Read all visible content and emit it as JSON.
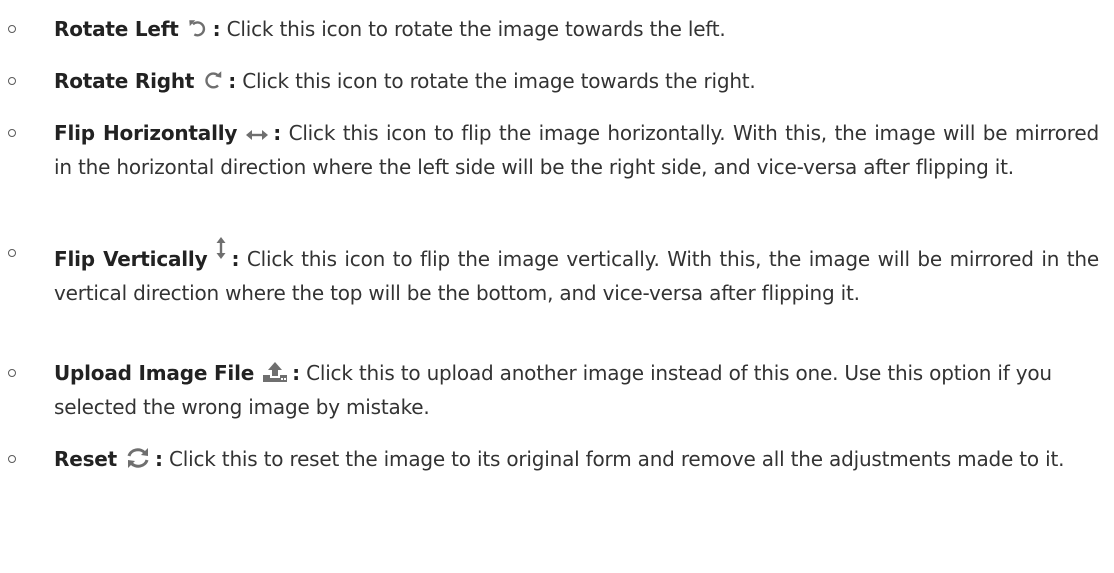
{
  "items": [
    {
      "term": "Rotate Left",
      "icon": "rotate-left-icon",
      "description": "Click this icon to rotate the image towards the left."
    },
    {
      "term": "Rotate Right",
      "icon": "rotate-right-icon",
      "description": "Click this icon to rotate the image towards the right."
    },
    {
      "term": "Flip Horizontally",
      "icon": "flip-horizontal-icon",
      "description": "Click this icon to flip the image horizontally. With this, the image will be mirrored in the horizontal direction where the left side will be the right side, and vice-versa after flipping it."
    },
    {
      "term": "Flip Vertically",
      "icon": "flip-vertical-icon",
      "description": "Click this icon to flip the image vertically. With this, the image will be mirrored in the vertical direction where the top will be the bottom, and vice-versa after flipping it."
    },
    {
      "term": "Upload Image File",
      "icon": "upload-icon",
      "description": "Click this to upload another image instead of this one. Use this option if you selected the wrong image by mistake."
    },
    {
      "term": "Reset",
      "icon": "reset-icon",
      "description": "Click this to reset the image to its original form and remove all the adjustments made to it."
    }
  ],
  "separator": ":",
  "colors": {
    "text": "#333333",
    "icon": "#6f6f6f",
    "bullet": "#5a5a5a"
  }
}
